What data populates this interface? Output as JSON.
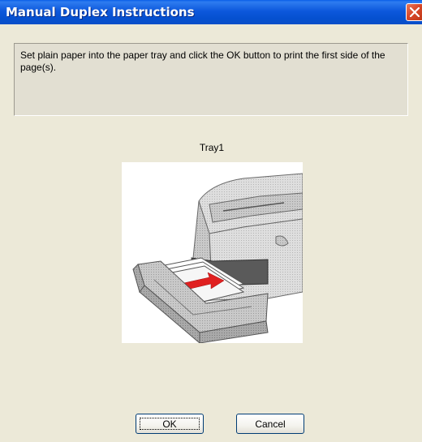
{
  "window": {
    "title": "Manual Duplex Instructions",
    "close_icon": "close-icon"
  },
  "message": {
    "text": "Set plain paper into the paper tray and click the OK button to print the first side of the page(s)."
  },
  "illustration": {
    "label": "Tray1",
    "icon": "printer-paper-tray-illustration"
  },
  "buttons": {
    "ok_label": "OK",
    "cancel_label": "Cancel"
  },
  "colors": {
    "titlebar": "#0550d0",
    "dialog_bg": "#ece9d8",
    "close_button": "#d8482a",
    "paper_arrow": "#e02020"
  }
}
